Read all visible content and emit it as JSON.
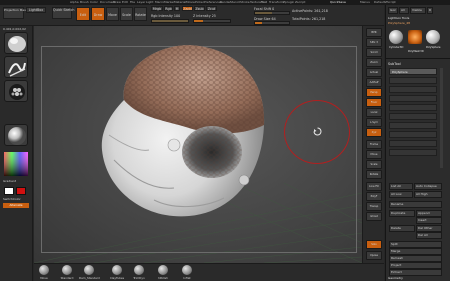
{
  "menu": [
    "Alpha",
    "Brush",
    "Color",
    "Document",
    "Draw",
    "Edit",
    "File",
    "Layer",
    "Light",
    "Macro",
    "Marker",
    "Material",
    "Movie",
    "Picker",
    "Preferences",
    "Render",
    "Stencil",
    "Stroke",
    "Texture",
    "Tool",
    "Transform",
    "Zplugin",
    "Zscript"
  ],
  "menu_right": [
    "QuickSave",
    "Menus",
    "DefaultZScript"
  ],
  "toolbar": {
    "projection_master": "Projection Master",
    "lightbox": "LightBox",
    "quick_sketch": "Quick Sketch",
    "edit": "Edit",
    "draw": "Draw",
    "move": "Move",
    "scale": "Scale",
    "rotate": "Rotate",
    "mrgb": "Mrgb",
    "rgb": "Rgb",
    "m": "M",
    "zadd": "Zadd",
    "zsub": "Zsub",
    "zcut": "Zcut",
    "rgb_intensity": "Rgb Intensity 100",
    "z_intensity": "Z Intensity 25",
    "focal_shift": "Focal Shift 0",
    "draw_size": "Draw Size 64",
    "active_points": "ActivePoints: 261,218",
    "total_points": "TotalPoints: 261,218"
  },
  "left": {
    "coords": "0.401,0.002,02",
    "gradient": "Gradient",
    "switch_color": "SwitchColor",
    "alternate": "Alternate"
  },
  "right_shelf": [
    "BPR",
    "SPix 3",
    "Scroll",
    "Zoom",
    "Actual",
    "AAHalf",
    "Persp",
    "Floor",
    "Local",
    "L.Sym",
    "Xyz",
    "Frame",
    "Move",
    "Scale",
    "Rotate",
    "Line Fill",
    "PolyF",
    "Transp",
    "Ghost",
    "Solo",
    "Xpose"
  ],
  "palette": {
    "header": [
      "Goz",
      "All",
      "Visible",
      "R"
    ],
    "lightbox_tools": "Lightbox Tools",
    "current_tool": "PolySphere_48",
    "tool_names": [
      "Cylinder3D",
      "PolyMesh3D",
      "PolySphere"
    ],
    "subtool": "SubTool",
    "subtool_active": "PolySphere",
    "list_all": "List All",
    "auto_collapse": "Auto Collapse",
    "all_low": "All Low",
    "all_high": "All High",
    "rename": "Rename",
    "duplicate": "Duplicate",
    "append": "Append",
    "insert": "Insert",
    "delete": "Delete",
    "del_other": "Del Other",
    "del_all": "Del All",
    "split": "Split",
    "merge": "Merge",
    "remesh": "Remesh",
    "project": "Project",
    "extract": "Extract",
    "geometry": "Geometry"
  },
  "bottom_shelf": [
    "Move",
    "Standard",
    "Dam_Standard",
    "ClayTubes",
    "TrimDyn",
    "hPolish",
    "Inflat"
  ],
  "colors": {
    "accent": "#c85f10",
    "cursor_ring": "#b02020",
    "primary_color": "#ffffff",
    "secondary_color": "#d01010"
  }
}
